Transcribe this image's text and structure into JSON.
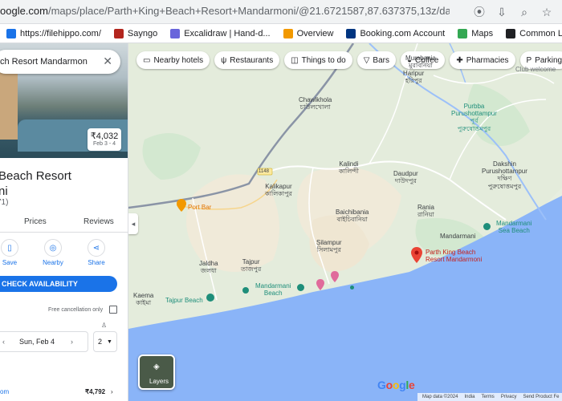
{
  "browser": {
    "url_host": "oogle.com",
    "url_path": "/maps/place/Parth+King+Beach+Resort+Mandarmoni/@21.6721587,87.637375,13z/data=!4m10!3m9!1s0x3a03...",
    "icons": [
      "location-icon",
      "install-icon",
      "zoom-icon",
      "star-icon"
    ]
  },
  "bookmarks": [
    {
      "label": "https://filehippo.com/",
      "icon": "grid-icon",
      "color": "#1a73e8"
    },
    {
      "label": "Sayngo",
      "icon": "sayngo-icon",
      "color": "#b3261e"
    },
    {
      "label": "Excalidraw | Hand-d...",
      "icon": "excalidraw-icon",
      "color": "#6965db"
    },
    {
      "label": "Overview",
      "icon": "overview-icon",
      "color": "#f29900"
    },
    {
      "label": "Booking.com Account",
      "icon": "booking-icon",
      "color": "#003580"
    },
    {
      "label": "Maps",
      "icon": "maps-icon",
      "color": "#34a853"
    },
    {
      "label": "Common Login Page",
      "icon": "globe-icon",
      "color": "#202124"
    }
  ],
  "chips": [
    {
      "label": "Nearby hotels",
      "icon": "bed-icon"
    },
    {
      "label": "Restaurants",
      "icon": "fork-knife-icon"
    },
    {
      "label": "Things to do",
      "icon": "camera-icon"
    },
    {
      "label": "Bars",
      "icon": "glass-icon"
    },
    {
      "label": "Coffee",
      "icon": "coffee-icon"
    },
    {
      "label": "Pharmacies",
      "icon": "pharmacy-icon"
    },
    {
      "label": "Parking",
      "icon": "parking-icon"
    }
  ],
  "map_labels": {
    "murabania": "Murabania\nমুরাবনিয়া",
    "haripur": "Haripur\nহরিপুর",
    "chawlkhola": "Chawlkhola\nচাউলখোলা",
    "purba": "Purbba\nPurushottampur\nপূর্ব\nপুরুষোত্তমপুর",
    "kalindi": "Kalindi\nকালিন্দী",
    "daudpur": "Daudpur\nদাউদপুর",
    "dakshin": "Dakshin\nPurushottampur\nদক্ষিণ\nপুরুষোত্তমপুর",
    "kalikapur": "Kalikapur\nকালিকাপুর",
    "baichibania": "Baichibania\nবাইচিবানিয়া",
    "rania": "Rania\nরানিয়া",
    "mandarmani": "Mandarmani",
    "mandarmani_sea_beach": "Mandarmani\nSea Beach",
    "silampur": "Silampur\nসিলামপুর",
    "jaldha": "Jaldha\nজলধা",
    "tajpur": "Tajpur\nতাজপুর",
    "mandarmani_beach": "Mandarmani\nBeach",
    "kaema": "Kaema\nকাইমা",
    "tajpur_beach": "Tajpur Beach",
    "port_bar": "Port Bar",
    "parth_king": "Parth King Beach\nResort Mandarmoni",
    "club": "Club welcome",
    "road_number": "1148"
  },
  "map_footer": {
    "data": "Map data ©2024",
    "links": [
      "India",
      "Terms",
      "Privacy",
      "Send Product Fe"
    ]
  },
  "layers_label": "Layers",
  "google_logo": "Google",
  "panel": {
    "search_value": "ch Resort Mandarmon",
    "price": "₹4,032",
    "dates": "Feb 3 - 4",
    "title_line1": "Beach Resort",
    "title_line2": "ni",
    "rating_text": "71)",
    "tabs": [
      "Prices",
      "Reviews"
    ],
    "actions": [
      {
        "label": "Save",
        "icon": "bookmark-icon"
      },
      {
        "label": "Nearby",
        "icon": "nearby-icon"
      },
      {
        "label": "Share",
        "icon": "share-icon"
      }
    ],
    "cta": "CHECK AVAILABILITY",
    "free_cancel": "Free cancellation only",
    "checkout": "Sun, Feb 4",
    "guests": "2",
    "bottom_price": "₹4,792",
    "bottom_link": "om"
  },
  "colors": {
    "accent": "#1a73e8",
    "sea": "#8ab4f8",
    "land": "#e7eee0",
    "pin": "#ea4335"
  }
}
